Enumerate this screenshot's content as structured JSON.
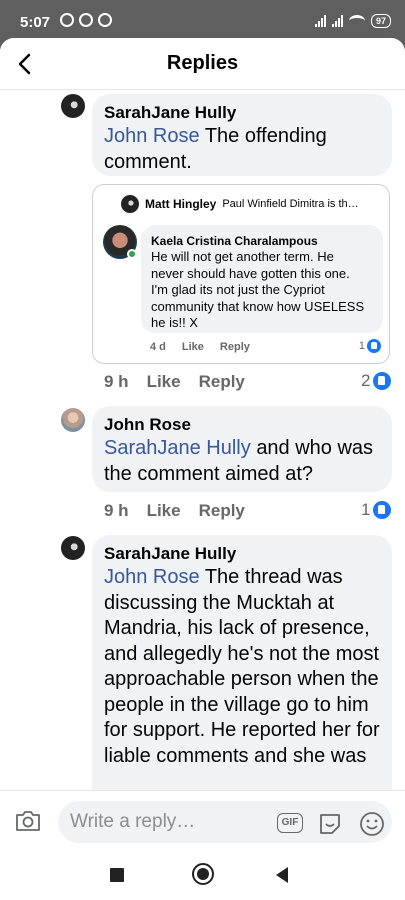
{
  "status_bar": {
    "time": "5:07",
    "battery": "97"
  },
  "header": {
    "title": "Replies"
  },
  "comments": [
    {
      "author": "SarahJane Hully",
      "mention": "John Rose",
      "text": "The offending comment.",
      "shared": {
        "header_name": "Matt Hingley",
        "header_snippet": "Paul Winfield Dimitra is th…",
        "author": "Kaela Cristina Charalampous",
        "lines": [
          "He will not get another term. He",
          "never should have gotten this one.",
          "I'm glad its not just the Cypriot",
          "community that know how  USELESS",
          "he is!! X"
        ],
        "time": "4 d",
        "like": "Like",
        "reply": "Reply",
        "reactions": "1"
      },
      "time": "9 h",
      "like": "Like",
      "reply": "Reply",
      "reactions": "2"
    },
    {
      "author": "John Rose",
      "mention": "SarahJane Hully",
      "text": "and who was the comment aimed at?",
      "time": "9 h",
      "like": "Like",
      "reply": "Reply",
      "reactions": "1"
    },
    {
      "author": "SarahJane Hully",
      "mention": "John Rose",
      "text": "The thread was discussing the Mucktah at Mandria, his lack of presence, and  allegedly he's not the most approachable person when the people in the village go to him for support. He reported her for liable comments and she was"
    }
  ],
  "composer": {
    "placeholder": "Write a reply…",
    "gif_label": "GIF"
  }
}
